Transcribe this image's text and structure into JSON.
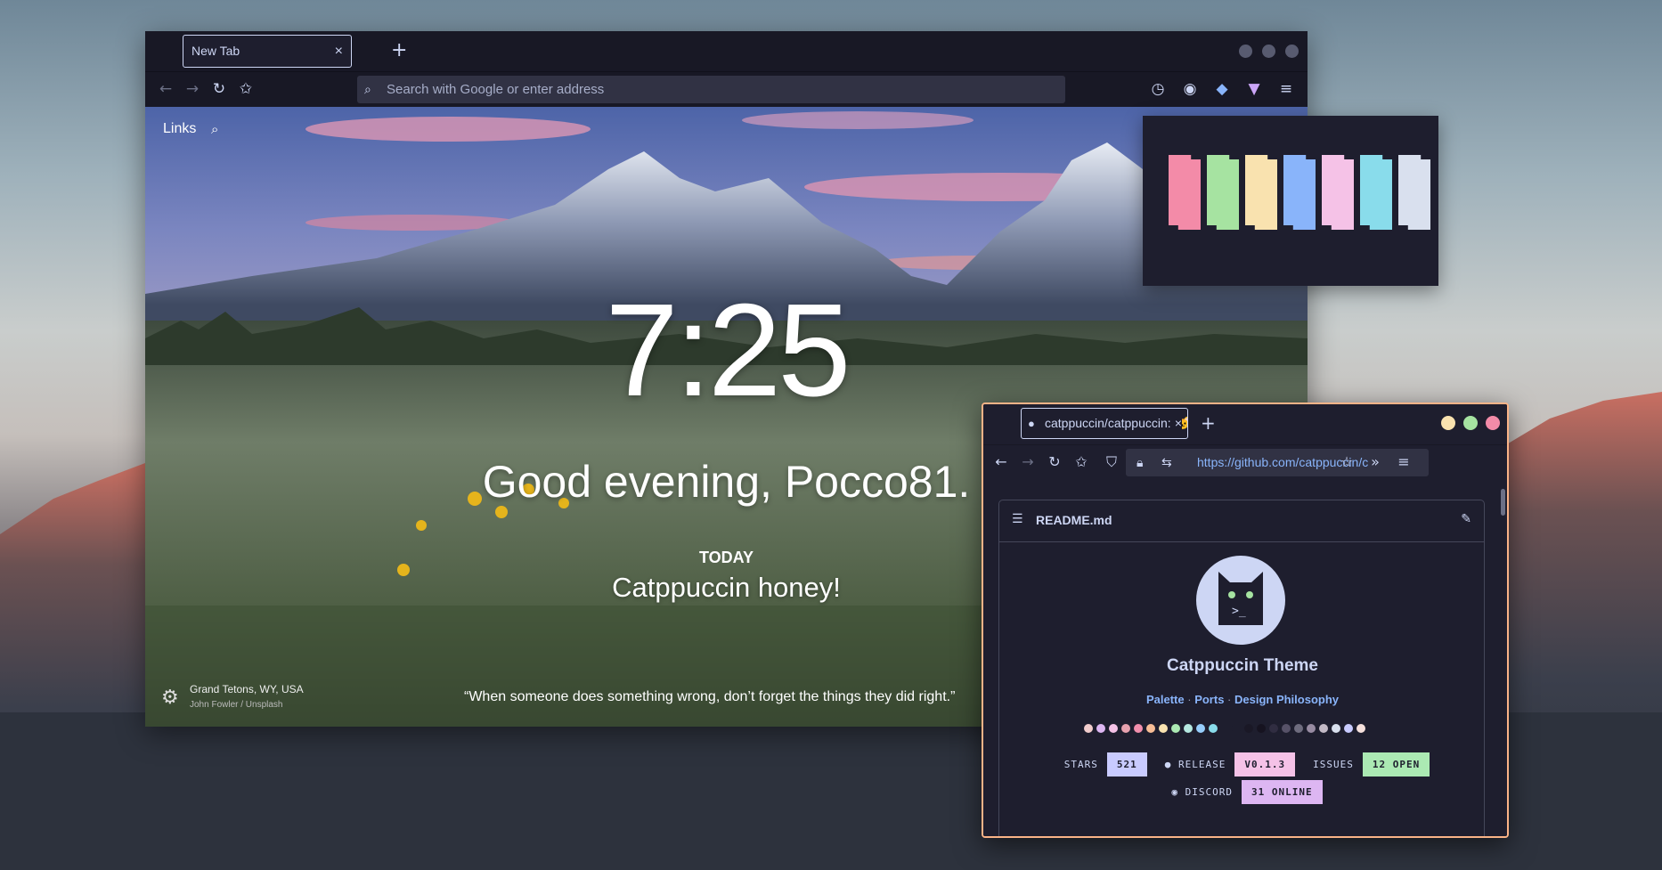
{
  "browser": {
    "tab_title": "New Tab",
    "tab_close": "×",
    "new_tab": "+",
    "address_placeholder": "Search with Google or enter address"
  },
  "newtab": {
    "links_label": "Links",
    "clock": "7:25",
    "greeting": "Good evening, Pocco81.",
    "today_label": "TODAY",
    "today_text": "Catppuccin honey!",
    "location": "Grand Tetons, WY, USA",
    "credit": "John Fowler / Unsplash",
    "quote": "“When someone does something wrong, don’t forget the things they did right.”"
  },
  "palette": {
    "colors": [
      "#f38ba8",
      "#a6e3a1",
      "#f9e2af",
      "#89b4fa",
      "#f5c2e7",
      "#89dceb",
      "#d9e0ee"
    ]
  },
  "github": {
    "tab_title": "catppuccin/catppuccin: 🐱",
    "tab_close": "×",
    "new_tab": "+",
    "url": "https://github.com/catppuccin/c",
    "readme_filename": "README.md",
    "title": "Catppuccin Theme",
    "links": [
      "Palette",
      "Ports",
      "Design Philosophy"
    ],
    "link_sep": " · ",
    "dots": [
      "#f2cdcd",
      "#ddb6f2",
      "#f5c2e7",
      "#e8a2af",
      "#f28fad",
      "#f8bd96",
      "#fae3b0",
      "#abe9b3",
      "#b5e8e0",
      "#96cdfb",
      "#89dceb",
      "#1e1e2e",
      "#1a1826",
      "#161320",
      "#302d41",
      "#575268",
      "#6e6c7e",
      "#988ba2",
      "#c3bac6",
      "#d9e0ee",
      "#c9cbff",
      "#f5e0dc"
    ],
    "badges": {
      "stars_label": "STARS",
      "stars_value": "521",
      "release_label": "RELEASE",
      "release_value": "V0.1.3",
      "issues_label": "ISSUES",
      "issues_value": "12 OPEN",
      "discord_label": "DISCORD",
      "discord_value": "31 ONLINE"
    },
    "badge_colors": {
      "stars": "#c9cbff",
      "release": "#f5c2e7",
      "issues": "#abe9b3",
      "discord": "#ddb6f2"
    },
    "window_dots": [
      "#f9e2af",
      "#a6e3a1",
      "#f38ba8"
    ]
  }
}
